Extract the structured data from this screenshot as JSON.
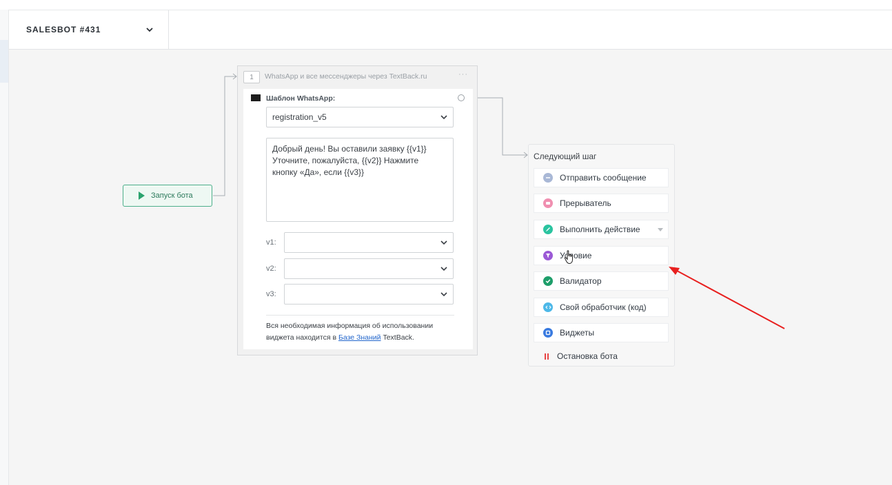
{
  "header": {
    "bot_name": "SALESBOT #431"
  },
  "start_node": {
    "label": "Запуск бота"
  },
  "block": {
    "number": "1",
    "title": "WhatsApp и все мессенджеры через TextBack.ru",
    "menu": "···",
    "template_label": "Шаблон WhatsApp:",
    "template_value": "registration_v5",
    "message": "Добрый день! Вы оставили заявку {{v1}}\nУточните, пожалуйста, {{v2}} Нажмите\nкнопку «Да», если {{v3}}",
    "vars": [
      {
        "label": "v1:",
        "value": ""
      },
      {
        "label": "v2:",
        "value": ""
      },
      {
        "label": "v3:",
        "value": ""
      }
    ],
    "info_prefix": "Вся необходимая информация об использовании виджета находится в ",
    "info_link": "Базе Знаний",
    "info_suffix": " TextBack."
  },
  "next_step": {
    "title": "Следующий шаг",
    "items": [
      {
        "label": "Отправить сообщение",
        "icon": "message-icon",
        "color": "#a9b8d6"
      },
      {
        "label": "Прерыватель",
        "icon": "interrupter-icon",
        "color": "#f08fb0"
      },
      {
        "label": "Выполнить действие",
        "icon": "pencil-icon",
        "color": "#2bc4a0"
      },
      {
        "label": "Условие",
        "icon": "filter-icon",
        "color": "#9b59d6"
      },
      {
        "label": "Валидатор",
        "icon": "check-icon",
        "color": "#1e9e6a"
      },
      {
        "label": "Свой обработчик (код)",
        "icon": "code-icon",
        "color": "#4db8e8"
      },
      {
        "label": "Виджеты",
        "icon": "widget-icon",
        "color": "#3a7be0"
      }
    ],
    "stop_label": "Остановка бота",
    "stop_color": "#e84545"
  },
  "colors": {
    "accent_green": "#2ba36e",
    "annotation_arrow": "#e8201f",
    "link": "#2266cc"
  }
}
